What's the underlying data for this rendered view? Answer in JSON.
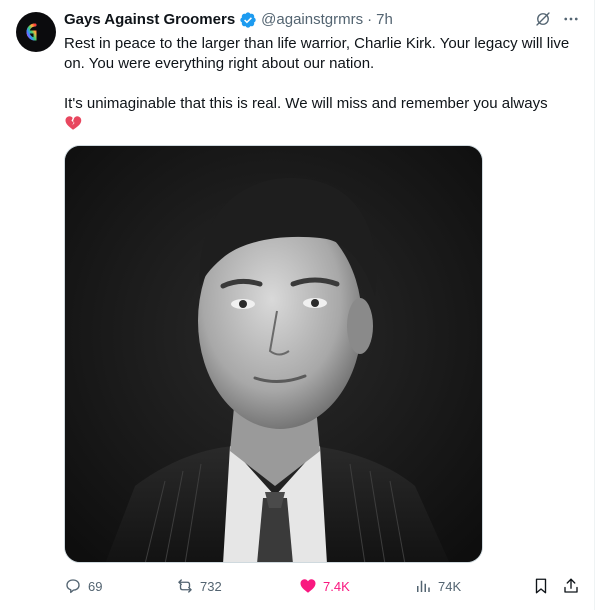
{
  "author": {
    "name": "Gays Against Groomers",
    "handle": "@againstgrmrs",
    "separator": "·",
    "time": "7h",
    "verified": true,
    "avatar_icon": "gg-logo-icon"
  },
  "tweet": {
    "paragraph1": "Rest in peace to the larger than life warrior, Charlie Kirk. Your legacy will live on. You were everything right about our nation.",
    "paragraph2": "It's unimaginable that this is real. We will miss and remember you always",
    "emoji": "broken-heart-icon"
  },
  "media": {
    "type": "photo",
    "style": "black-and-white portrait"
  },
  "actions": {
    "replies": "69",
    "reposts": "732",
    "likes": "7.4K",
    "views": "74K",
    "like_color": "#f91880"
  },
  "colors": {
    "text": "#0f1419",
    "secondary": "#536471",
    "verified": "#1d9bf0",
    "like": "#f91880"
  }
}
